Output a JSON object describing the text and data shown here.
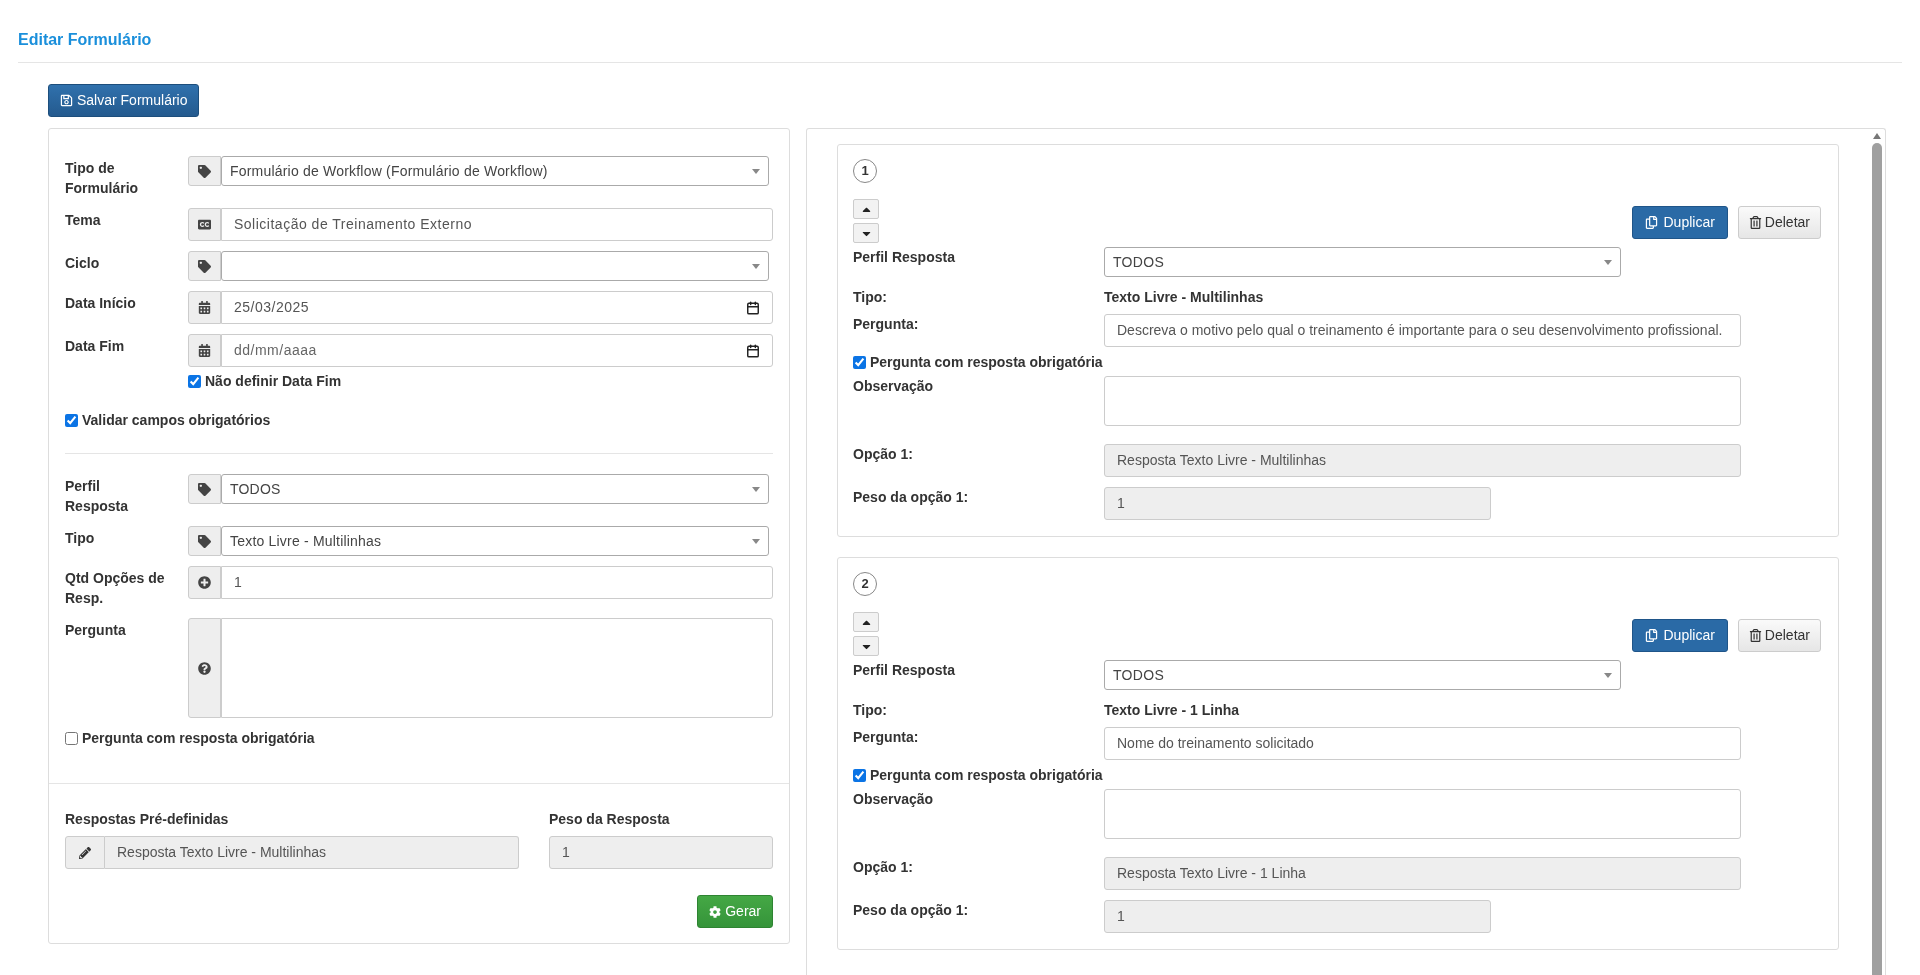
{
  "page_title": "Editar Formulário",
  "save_button": "Salvar Formulário",
  "form": {
    "fields": [
      {
        "kind": "select",
        "label": "Tipo de Formulário",
        "value": "Formulário de Workflow (Formulário de Workflow)"
      },
      {
        "kind": "text",
        "label": "Tema",
        "value": "Solicitação de Treinamento Externo"
      },
      {
        "kind": "select",
        "label": "Ciclo"
      },
      {
        "kind": "date",
        "label": "Data Início",
        "value": "25/03/2025"
      },
      {
        "kind": "date",
        "label": "Data Fim",
        "placeholder": "dd/mm/aaaa",
        "checkbox": {
          "label": "Não definir Data Fim",
          "checked": true
        }
      }
    ],
    "validate_checkbox": {
      "label": "Validar campos obrigatórios",
      "checked": true
    }
  },
  "question_editor": {
    "fields": [
      {
        "kind": "select",
        "label": "Perfil Resposta",
        "value": "TODOS"
      },
      {
        "kind": "select",
        "label": "Tipo",
        "value": "Texto Livre - Multilinhas"
      },
      {
        "kind": "number",
        "label": "Qtd Opções de Resp.",
        "value": "1"
      },
      {
        "kind": "textarea",
        "label": "Pergunta"
      }
    ],
    "required_checkbox": {
      "label": "Pergunta com resposta obrigatória",
      "checked": false
    }
  },
  "predefined": {
    "answers_label": "Respostas Pré-definidas",
    "answer_value": "Resposta Texto Livre - Multilinhas",
    "weight_label": "Peso da Resposta",
    "weight_value": "1",
    "generate_button": "Gerar"
  },
  "questions": [
    {
      "number": "1",
      "duplicate_button": "Duplicar",
      "delete_button": "Deletar",
      "profile_label": "Perfil Resposta",
      "profile_value": "TODOS",
      "type_label": "Tipo:",
      "type_value": "Texto Livre - Multilinhas",
      "question_label": "Pergunta:",
      "question_value": "Descreva o motivo pelo qual o treinamento é importante para o seu desenvolvimento profissional.",
      "required": {
        "label": "Pergunta com resposta obrigatória",
        "checked": true
      },
      "note_label": "Observação",
      "option_label": "Opção 1:",
      "option_value": "Resposta Texto Livre - Multilinhas",
      "weight_label": "Peso da opção 1:",
      "weight_value": "1"
    },
    {
      "number": "2",
      "duplicate_button": "Duplicar",
      "delete_button": "Deletar",
      "profile_label": "Perfil Resposta",
      "profile_value": "TODOS",
      "type_label": "Tipo:",
      "type_value": "Texto Livre - 1 Linha",
      "question_label": "Pergunta:",
      "question_value": "Nome do treinamento solicitado",
      "required": {
        "label": "Pergunta com resposta obrigatória",
        "checked": true
      },
      "note_label": "Observação",
      "option_label": "Opção 1:",
      "option_value": "Resposta Texto Livre -  1 Linha",
      "weight_label": "Peso da opção 1:",
      "weight_value": "1"
    }
  ]
}
